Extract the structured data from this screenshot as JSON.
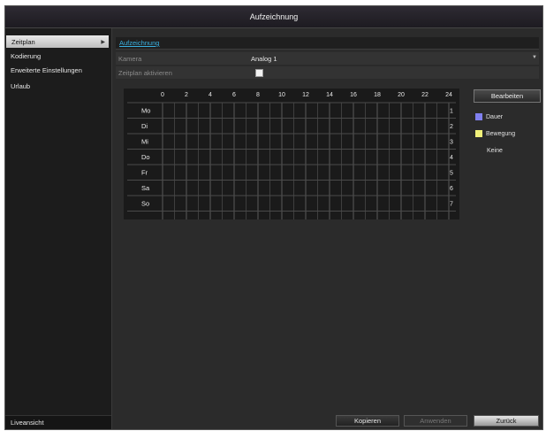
{
  "title": "Aufzeichnung",
  "sidebar": {
    "items": [
      {
        "label": "Zeitplan",
        "active": true
      },
      {
        "label": "Kodierung"
      },
      {
        "label": "Erweiterte Einstellungen"
      },
      {
        "label": "Urlaub"
      }
    ],
    "bottom_label": "Liveansicht"
  },
  "tabs": [
    {
      "label": "Aufzeichnung"
    }
  ],
  "fields": {
    "camera_label": "Kamera",
    "camera_value": "Analog 1",
    "schedule_label": "Zeitplan aktivieren",
    "schedule_checked": true
  },
  "schedule": {
    "hours": [
      "0",
      "2",
      "4",
      "6",
      "8",
      "10",
      "12",
      "14",
      "16",
      "18",
      "20",
      "22",
      "24"
    ],
    "days": [
      "Mo",
      "Di",
      "Mi",
      "Do",
      "Fr",
      "Sa",
      "So"
    ],
    "day_numbers": [
      "1",
      "2",
      "3",
      "4",
      "5",
      "6",
      "7"
    ]
  },
  "edit_button": "Bearbeiten",
  "legend": [
    {
      "label": "Dauer",
      "color": "#8080f0"
    },
    {
      "label": "Bewegung",
      "color": "#f0f07a"
    },
    {
      "label": "Keine",
      "color": null
    }
  ],
  "buttons": {
    "copy": "Kopieren",
    "apply": "Anwenden",
    "back": "Zurück"
  }
}
